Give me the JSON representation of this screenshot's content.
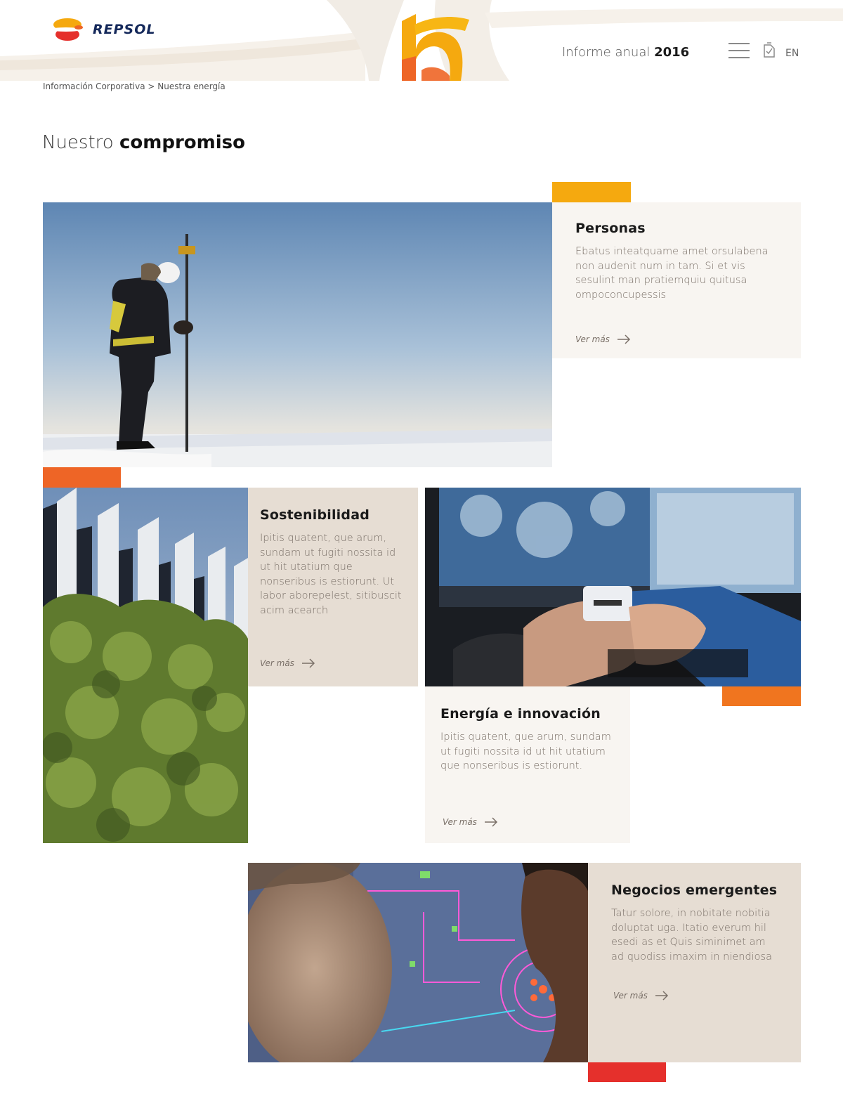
{
  "header": {
    "brand": "REPSOL",
    "report_prefix": "Informe anual",
    "report_year": "2016",
    "lang": "EN"
  },
  "breadcrumb": {
    "parent": "Información Corporativa",
    "separator": ">",
    "current": "Nuestra energía"
  },
  "page": {
    "title_light": "Nuestro",
    "title_bold": "compromiso"
  },
  "cards": {
    "personas": {
      "title": "Personas",
      "text": "Ebatus inteatquame amet orsulabena non audenit num in tam. Si et vis sesulint man pratiemquiu quitusa ompoconcupessis",
      "more": "Ver más"
    },
    "sostenibilidad": {
      "title": "Sostenibilidad",
      "text": "Ipitis quatent, que arum, sundam ut fugiti nossita id ut hit utatium que nonseribus is estiorunt. Ut labor aborepelest, sitibuscit acim acearch",
      "more": "Ver más"
    },
    "energia": {
      "title": "Energía e innovación",
      "text": "Ipitis quatent, que arum, sundam ut fugiti nossita id ut hit utatium que nonseribus is estiorunt.",
      "more": "Ver más"
    },
    "negocios": {
      "title": "Negocios emergentes",
      "text": "Tatur solore, in nobitate nobitia doluptat uga. Itatio everum hil esedi as et Quis siminimet am ad quodiss imaxim in niendiosa",
      "more": "Ver más"
    }
  },
  "colors": {
    "accent_yellow": "#f5a90f",
    "accent_orange": "#ee6526",
    "accent_orange2": "#f0751f",
    "accent_red": "#e5302c",
    "card_light": "#f8f5f1",
    "card_beige": "#e6ddd3"
  }
}
